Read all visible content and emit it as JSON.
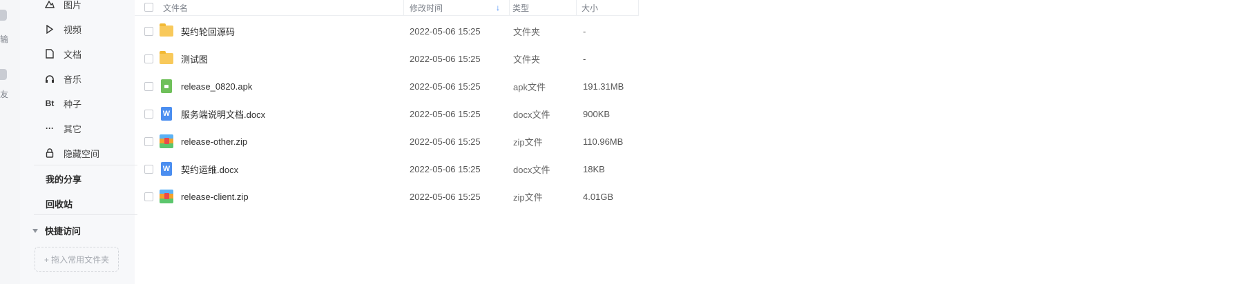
{
  "rail": {
    "items": [
      {
        "label": "输",
        "icon": "cube-icon"
      },
      {
        "label": "友",
        "icon": "user-icon"
      }
    ]
  },
  "sidebar": {
    "nav_items": [
      {
        "label": "图片",
        "icon": "image-icon"
      },
      {
        "label": "视频",
        "icon": "play-icon"
      },
      {
        "label": "文档",
        "icon": "document-icon"
      },
      {
        "label": "音乐",
        "icon": "headphones-icon"
      },
      {
        "label": "种子",
        "icon": "bt-icon",
        "icon_text": "Bt"
      },
      {
        "label": "其它",
        "icon": "more-icon",
        "icon_text": "···"
      },
      {
        "label": "隐藏空间",
        "icon": "lock-icon"
      }
    ],
    "my_share": "我的分享",
    "recycle_bin": "回收站",
    "quick_access": "快捷访问",
    "drop_folder_hint": "+ 拖入常用文件夹"
  },
  "table": {
    "headers": {
      "name": "文件名",
      "modified": "修改时间",
      "type": "类型",
      "size": "大小"
    },
    "sort_indicator": "↓",
    "rows": [
      {
        "name": "契约轮回源码",
        "modified": "2022-05-06 15:25",
        "type": "文件夹",
        "size": "-",
        "icon": "folder-icon"
      },
      {
        "name": "测试图",
        "modified": "2022-05-06 15:25",
        "type": "文件夹",
        "size": "-",
        "icon": "folder-icon"
      },
      {
        "name": "release_0820.apk",
        "modified": "2022-05-06 15:25",
        "type": "apk文件",
        "size": "191.31MB",
        "icon": "apk-file-icon"
      },
      {
        "name": "服务端说明文档.docx",
        "modified": "2022-05-06 15:25",
        "type": "docx文件",
        "size": "900KB",
        "icon": "word-file-icon"
      },
      {
        "name": "release-other.zip",
        "modified": "2022-05-06 15:25",
        "type": "zip文件",
        "size": "110.96MB",
        "icon": "zip-file-icon"
      },
      {
        "name": "契约运维.docx",
        "modified": "2022-05-06 15:25",
        "type": "docx文件",
        "size": "18KB",
        "icon": "word-file-icon"
      },
      {
        "name": "release-client.zip",
        "modified": "2022-05-06 15:25",
        "type": "zip文件",
        "size": "4.01GB",
        "icon": "zip-file-icon"
      }
    ]
  },
  "colors": {
    "sort_arrow": "#2f7df6",
    "folder": "#f8c95b",
    "apk": "#6fc05a",
    "docx": "#4b8ef0"
  }
}
